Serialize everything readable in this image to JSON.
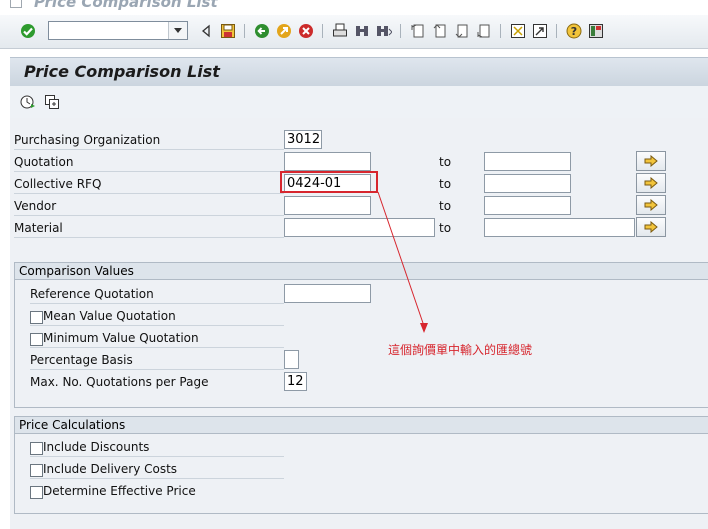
{
  "window": {
    "title": "Price Comparison List"
  },
  "toolbar": {
    "command_field_value": ""
  },
  "page": {
    "title": "Price Comparison List"
  },
  "selection": {
    "rows": [
      {
        "label": "Purchasing Organization",
        "from": "3012"
      },
      {
        "label": "Quotation",
        "from": "",
        "to_label": "to",
        "to": ""
      },
      {
        "label": "Collective RFQ",
        "from": "0424-01",
        "to_label": "to",
        "to": ""
      },
      {
        "label": "Vendor",
        "from": "",
        "to_label": "to",
        "to": ""
      },
      {
        "label": "Material",
        "from": "",
        "to_label": "to",
        "to": ""
      }
    ]
  },
  "comparison_values": {
    "title": "Comparison Values",
    "reference_quotation_label": "Reference Quotation",
    "reference_quotation_value": "",
    "mean_value_label": "Mean Value Quotation",
    "minimum_value_label": "Minimum Value Quotation",
    "percentage_basis_label": "Percentage Basis",
    "percentage_basis_value": "",
    "max_quotations_label": "Max. No. Quotations per Page",
    "max_quotations_value": "12"
  },
  "price_calculations": {
    "title": "Price Calculations",
    "include_discounts_label": "Include Discounts",
    "include_delivery_costs_label": "Include Delivery Costs",
    "determine_effective_price_label": "Determine Effective Price"
  },
  "annotation": {
    "text": "這個詢價單中輸入的匯總號",
    "color": "#d7262e"
  },
  "colors": {
    "accent": "#d7262e",
    "title_bar": "#cbd5df",
    "background": "#eef1f5"
  }
}
